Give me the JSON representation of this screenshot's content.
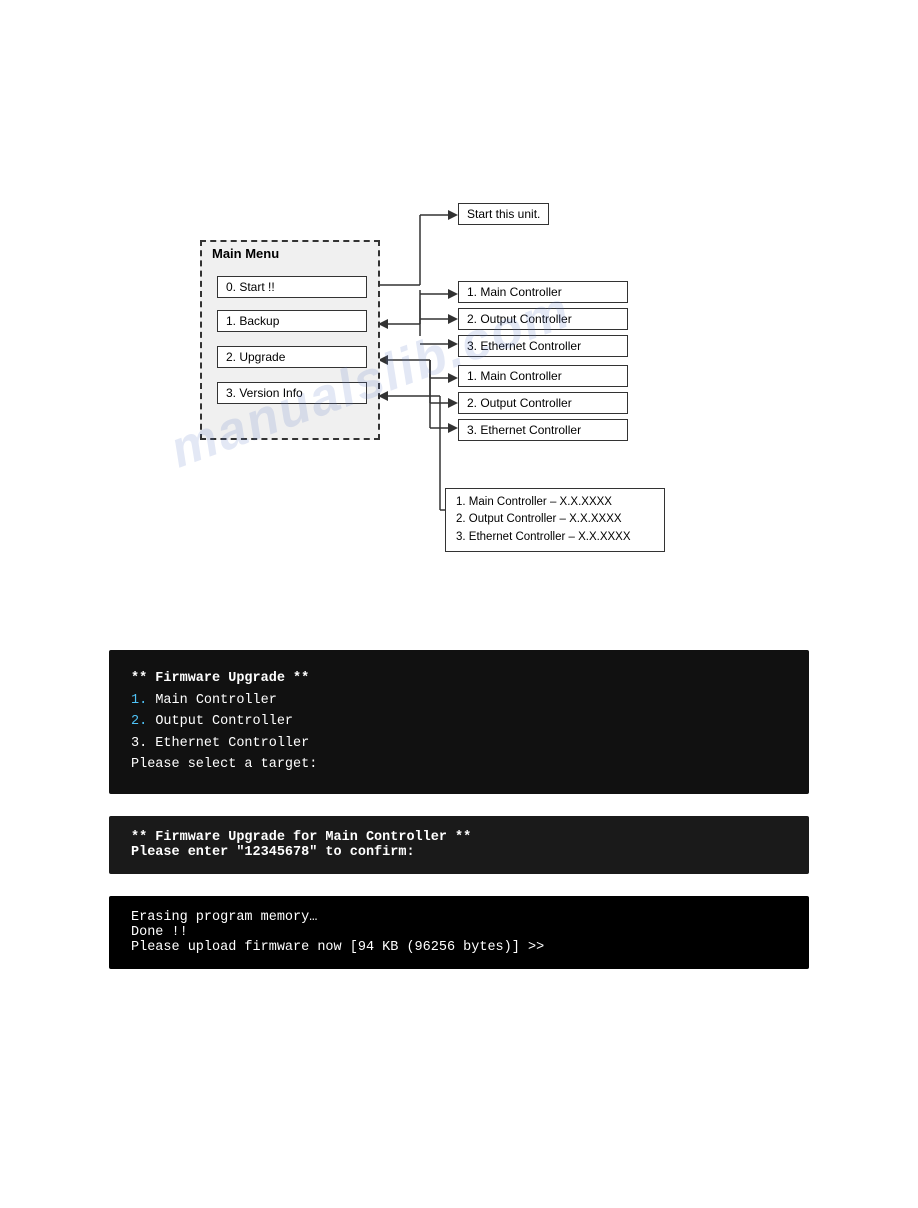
{
  "diagram": {
    "main_menu": {
      "title": "Main Menu",
      "items": [
        {
          "label": "0. Start !!",
          "id": "start"
        },
        {
          "label": "1. Backup",
          "id": "backup"
        },
        {
          "label": "2. Upgrade",
          "id": "upgrade"
        },
        {
          "label": "3. Version Info",
          "id": "version"
        }
      ]
    },
    "start_box": "Start this unit.",
    "backup_submenu": [
      "1. Main Controller",
      "2. Output Controller",
      "3. Ethernet Controller"
    ],
    "upgrade_submenu": [
      "1. Main Controller",
      "2. Output Controller",
      "3. Ethernet Controller"
    ],
    "version_submenu": [
      "1. Main Controller – X.X.XXXX",
      "2. Output Controller – X.X.XXXX",
      "3. Ethernet Controller – X.X.XXXX"
    ]
  },
  "terminal1": {
    "line1": "** Firmware Upgrade **",
    "line2": "1.  Main Controller",
    "line3": "2.  Output Controller",
    "line4": "3.  Ethernet Controller",
    "line5": "Please select a target:"
  },
  "terminal2": {
    "line1": "** Firmware Upgrade for Main Controller **",
    "line2": "Please enter \"12345678\" to confirm:"
  },
  "terminal3": {
    "line1": "Erasing program memory…",
    "line2": "Done !!",
    "line3": "Please upload firmware now [94 KB (96256 bytes)] >>"
  },
  "watermark": "manualslib.com"
}
